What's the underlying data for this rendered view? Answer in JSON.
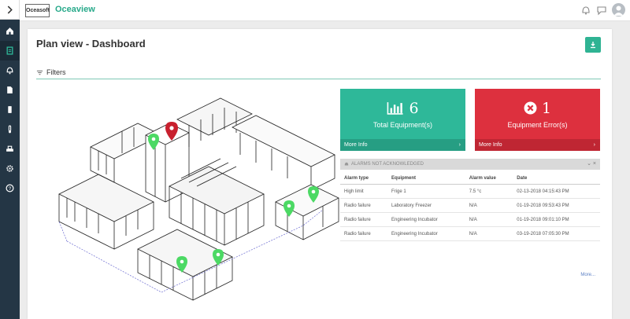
{
  "app": {
    "logo_text": "Oceasoft",
    "name": "Oceaview"
  },
  "sidebar": {
    "items": [
      {
        "icon": "home-icon"
      },
      {
        "icon": "floorplan-icon"
      },
      {
        "icon": "bell-icon"
      },
      {
        "icon": "report-icon"
      },
      {
        "icon": "device-icon"
      },
      {
        "icon": "thermometer-icon"
      },
      {
        "icon": "station-icon"
      },
      {
        "icon": "gear-icon"
      },
      {
        "icon": "help-icon"
      }
    ]
  },
  "page": {
    "title": "Plan view - Dashboard",
    "filters_label": "Filters"
  },
  "tiles": {
    "equipment": {
      "count": "6",
      "label": "Total Equipment(s)",
      "more": "More Info",
      "color": "#2eb899"
    },
    "errors": {
      "count": "1",
      "label": "Equipment Error(s)",
      "more": "More Info",
      "color": "#dd303e"
    }
  },
  "alarms": {
    "title": "ALARMS NOT ACKNOWLEDGED",
    "columns": [
      "Alarm type",
      "Equipment",
      "Alarm value",
      "Date"
    ],
    "rows": [
      [
        "High limit",
        "Frige 1",
        "7.5 °c",
        "02-13-2018 04:15:43 PM"
      ],
      [
        "Radio failure",
        "Laboratory Freezer",
        "N/A",
        "01-19-2018 09:53:43 PM"
      ],
      [
        "Radio failure",
        "Engineering Incubator",
        "N/A",
        "01-19-2018 09:01:10 PM"
      ],
      [
        "Radio failure",
        "Engineering Incubator",
        "N/A",
        "03-19-2018 07:05:30 PM"
      ]
    ],
    "more": "More..."
  }
}
